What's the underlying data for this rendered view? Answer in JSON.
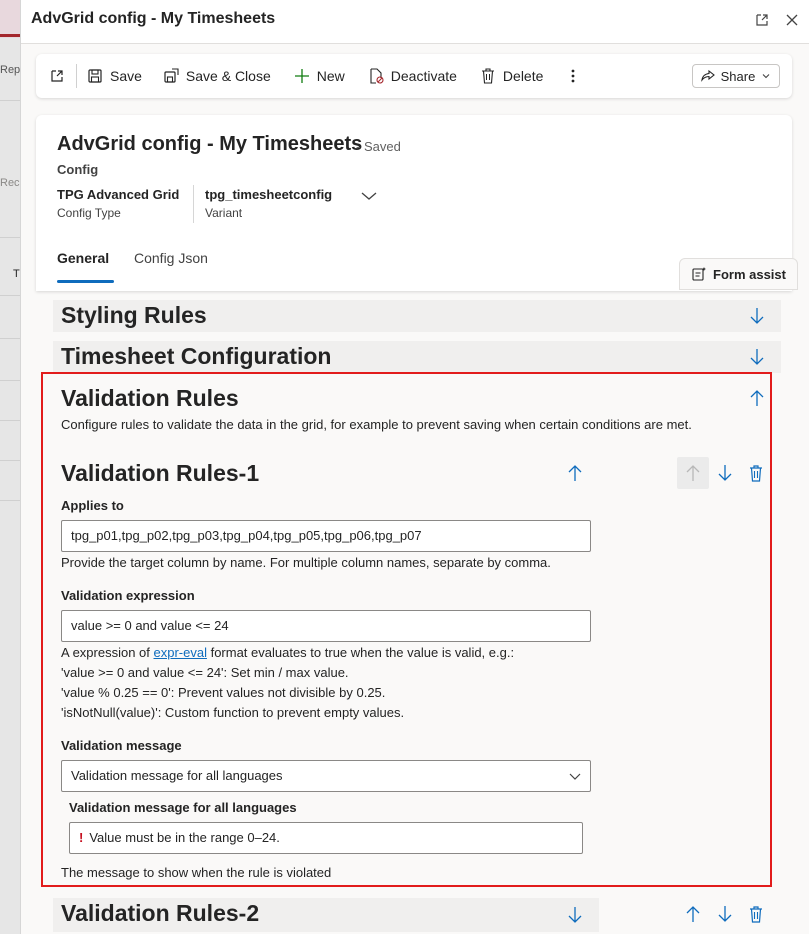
{
  "dialog": {
    "title": "AdvGrid config - My Timesheets"
  },
  "background_app": {
    "texts": [
      "Rep",
      "Rec",
      "T"
    ]
  },
  "toolbar": {
    "save_label": "Save",
    "save_close_label": "Save & Close",
    "new_label": "New",
    "deactivate_label": "Deactivate",
    "delete_label": "Delete",
    "share_label": "Share"
  },
  "record": {
    "title": "AdvGrid config - My Timesheets",
    "status": "- Saved",
    "entity": "Config",
    "fields": [
      {
        "value": "TPG Advanced Grid",
        "label": "Config Type"
      },
      {
        "value": "tpg_timesheetconfig",
        "label": "Variant"
      }
    ],
    "tabs": [
      "General",
      "Config Json"
    ],
    "form_assist_label": "Form assist"
  },
  "sections": {
    "styling_rules": "Styling Rules",
    "timesheet_configuration": "Timesheet Configuration",
    "validation_rules": "Validation Rules",
    "validation_rules_desc": "Configure rules to validate the data in the grid, for example to prevent saving when certain conditions are met.",
    "validation_rules_2": "Validation Rules-2"
  },
  "rule1": {
    "title": "Validation Rules-1",
    "applies_to_label": "Applies to",
    "applies_to_value": "tpg_p01,tpg_p02,tpg_p03,tpg_p04,tpg_p05,tpg_p06,tpg_p07",
    "applies_to_help": "Provide the target column by name. For multiple column names, separate by comma.",
    "expression_label": "Validation expression",
    "expression_value": "value >= 0 and value <= 24",
    "expression_help_prefix": "A expression of ",
    "expression_help_link": "expr-eval",
    "expression_help_suffix": " format evaluates to true when the value is valid, e.g.:",
    "expression_help_lines": [
      "'value >= 0 and value <= 24': Set min / max value.",
      "'value % 0.25 == 0': Prevent values not divisible by 0.25.",
      "'isNotNull(value)': Custom function to prevent empty values."
    ],
    "message_label": "Validation message",
    "message_select_value": "Validation message for all languages",
    "message_all_lang_label": "Validation message for all languages",
    "message_value": "Value must be in the range 0–24.",
    "message_help": "The message to show when the rule is violated"
  },
  "colors": {
    "accent": "#0f6cbd",
    "highlight_border": "#e21c1c",
    "error": "#c50f1f"
  }
}
